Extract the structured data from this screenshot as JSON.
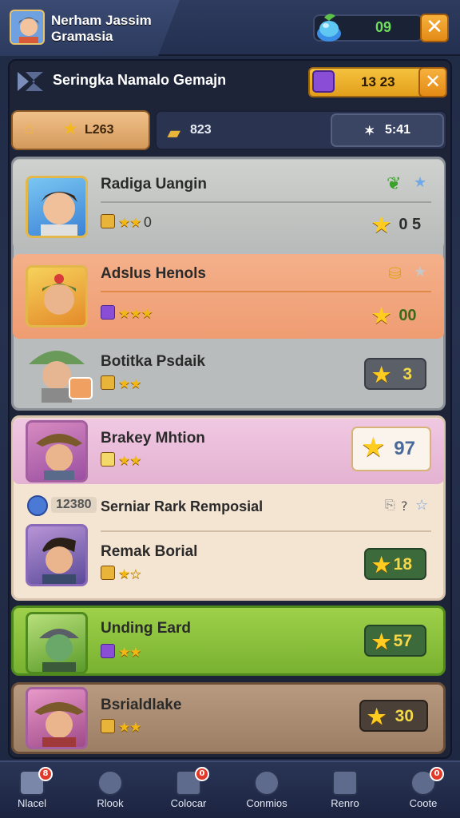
{
  "player": {
    "name": "Nerham Jassim",
    "subtitle": "Gramasia"
  },
  "gems": {
    "value": "09"
  },
  "panel": {
    "title": "Seringka Namalo Gemajn",
    "coins": "13 23"
  },
  "tabs": {
    "home_value": "L263",
    "stars_value": "823",
    "timer": "5:41"
  },
  "heroes": [
    {
      "name": "Radiga Uangin",
      "rank": "0",
      "score": "0 5"
    },
    {
      "name": "Adslus Henols",
      "score": "00"
    },
    {
      "name": "Botitka Psdaik",
      "score": "3"
    },
    {
      "name": "Brakey Mhtion",
      "score": "97"
    },
    {
      "name": "Serniar Rark Remposial",
      "badge_value": "12380",
      "hint": "?"
    },
    {
      "name": "Remak Borial",
      "score": "18"
    },
    {
      "name": "Unding Eard",
      "score": "57"
    },
    {
      "name": "Bsrialdlake",
      "score": "30"
    }
  ],
  "nav": [
    {
      "label": "Nlacel",
      "badge": "8"
    },
    {
      "label": "Rlook"
    },
    {
      "label": "Colocar",
      "badge": "0"
    },
    {
      "label": "Conmios"
    },
    {
      "label": "Renro"
    },
    {
      "label": "Coote",
      "badge": "0"
    }
  ],
  "colors": {
    "accent_orange": "#f0a030",
    "row_orange": "#f0a27a",
    "row_pink": "#e8b8d8",
    "row_green": "#8bc43c",
    "row_brown": "#a98a72",
    "gem_green": "#6fdc5a"
  }
}
